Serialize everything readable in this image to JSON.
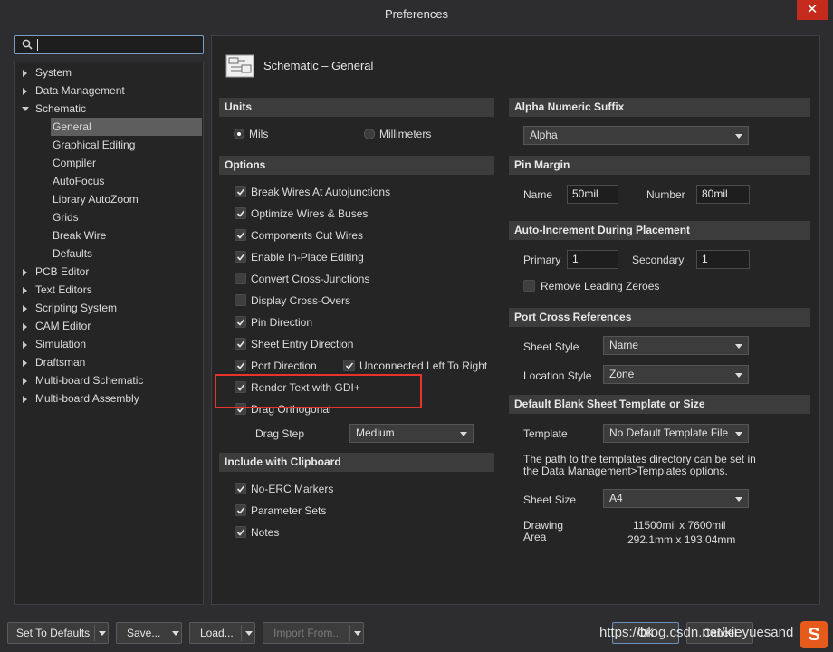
{
  "window": {
    "title": "Preferences",
    "close_glyph": "✕"
  },
  "search": {
    "placeholder": ""
  },
  "tree": [
    {
      "label": "System",
      "expanded": false,
      "level": 0
    },
    {
      "label": "Data Management",
      "expanded": false,
      "level": 0
    },
    {
      "label": "Schematic",
      "expanded": true,
      "level": 0
    },
    {
      "label": "General",
      "level": 1,
      "selected": true
    },
    {
      "label": "Graphical Editing",
      "level": 1
    },
    {
      "label": "Compiler",
      "level": 1
    },
    {
      "label": "AutoFocus",
      "level": 1
    },
    {
      "label": "Library AutoZoom",
      "level": 1
    },
    {
      "label": "Grids",
      "level": 1
    },
    {
      "label": "Break Wire",
      "level": 1
    },
    {
      "label": "Defaults",
      "level": 1
    },
    {
      "label": "PCB Editor",
      "expanded": false,
      "level": 0
    },
    {
      "label": "Text Editors",
      "expanded": false,
      "level": 0
    },
    {
      "label": "Scripting System",
      "expanded": false,
      "level": 0
    },
    {
      "label": "CAM Editor",
      "expanded": false,
      "level": 0
    },
    {
      "label": "Simulation",
      "expanded": false,
      "level": 0
    },
    {
      "label": "Draftsman",
      "expanded": false,
      "level": 0
    },
    {
      "label": "Multi-board Schematic",
      "expanded": false,
      "level": 0
    },
    {
      "label": "Multi-board Assembly",
      "expanded": false,
      "level": 0
    }
  ],
  "page": {
    "title": "Schematic – General"
  },
  "units": {
    "header": "Units",
    "mils": {
      "label": "Mils",
      "selected": true
    },
    "millimeters": {
      "label": "Millimeters",
      "selected": false
    }
  },
  "options": {
    "header": "Options",
    "items": [
      {
        "label": "Break Wires At Autojunctions",
        "checked": true
      },
      {
        "label": "Optimize Wires & Buses",
        "checked": true
      },
      {
        "label": "Components Cut Wires",
        "checked": true
      },
      {
        "label": "Enable In-Place Editing",
        "checked": true
      },
      {
        "label": "Convert Cross-Junctions",
        "checked": false
      },
      {
        "label": "Display Cross-Overs",
        "checked": false
      },
      {
        "label": "Pin Direction",
        "checked": true
      },
      {
        "label": "Sheet Entry Direction",
        "checked": true
      },
      {
        "label": "Port Direction",
        "checked": true
      },
      {
        "label": "Render Text with GDI+",
        "checked": true
      },
      {
        "label": "Drag Orthogonal",
        "checked": true
      }
    ],
    "unconnected": {
      "label": "Unconnected Left To Right",
      "checked": true
    },
    "drag_step": {
      "label": "Drag Step",
      "value": "Medium"
    }
  },
  "clipboard": {
    "header": "Include with Clipboard",
    "items": [
      {
        "label": "No-ERC Markers",
        "checked": true
      },
      {
        "label": "Parameter Sets",
        "checked": true
      },
      {
        "label": "Notes",
        "checked": true
      }
    ]
  },
  "alpha_suffix": {
    "header": "Alpha Numeric Suffix",
    "value": "Alpha"
  },
  "pin_margin": {
    "header": "Pin Margin",
    "name_label": "Name",
    "name_value": "50mil",
    "number_label": "Number",
    "number_value": "80mil"
  },
  "auto_increment": {
    "header": "Auto-Increment During Placement",
    "primary_label": "Primary",
    "primary_value": "1",
    "secondary_label": "Secondary",
    "secondary_value": "1",
    "remove_zeroes": {
      "label": "Remove Leading Zeroes",
      "checked": false
    }
  },
  "port_refs": {
    "header": "Port Cross References",
    "sheet_style_label": "Sheet Style",
    "sheet_style_value": "Name",
    "location_style_label": "Location Style",
    "location_style_value": "Zone"
  },
  "template": {
    "header": "Default Blank Sheet Template or Size",
    "template_label": "Template",
    "template_value": "No Default Template File",
    "note_line1": "The path to the templates directory can be set in",
    "note_line2": "the Data Management>Templates options.",
    "sheet_size_label": "Sheet Size",
    "sheet_size_value": "A4",
    "drawing_area_label1": "Drawing",
    "drawing_area_label2": "Area",
    "drawing_area_mil": "11500mil x 7600mil",
    "drawing_area_mm": "292.1mm x 193.04mm"
  },
  "footer": {
    "set_defaults": "Set To Defaults",
    "save": "Save...",
    "load": "Load...",
    "import_from": "Import From...",
    "ok": "OK",
    "cancel": "Cancel"
  },
  "watermark": "https://blog.csdn.net/kieyuesand",
  "logo_letter": "S",
  "colors": {
    "accent_highlight": "#e8322b",
    "panel": "#252526",
    "header": "#3c3c3c"
  }
}
